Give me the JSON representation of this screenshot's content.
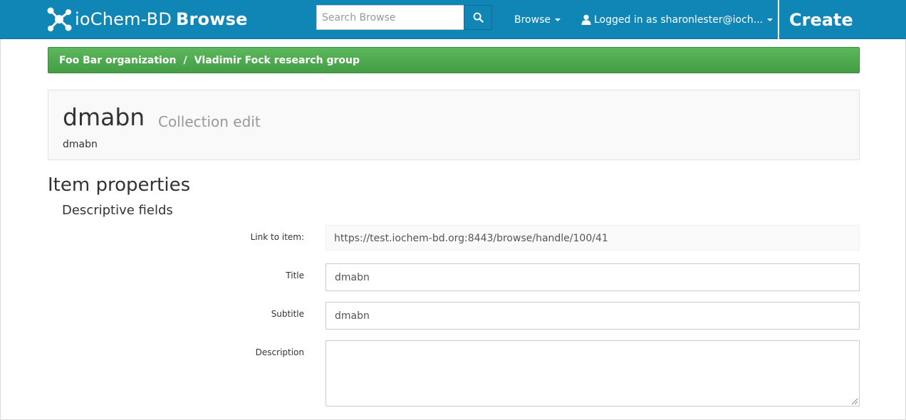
{
  "navbar": {
    "brand_name": "ioChem-BD",
    "brand_section": "Browse",
    "search_placeholder": "Search Browse",
    "browse_menu_label": "Browse",
    "user_menu_label": "Logged in as sharonlester@ioch...",
    "create_label": "Create",
    "bg_color": "#0f86b5"
  },
  "breadcrumb": {
    "items": [
      "Foo Bar organization",
      "Vladimir Fock research group"
    ],
    "separator": "/",
    "bg_color": "#5cb85c"
  },
  "header": {
    "title": "dmabn",
    "subtitle": "Collection edit",
    "description": "dmabn"
  },
  "main": {
    "section_title": "Item properties",
    "subsection_title": "Descriptive fields",
    "fields": {
      "link_label": "Link to item:",
      "link_value": "https://test.iochem-bd.org:8443/browse/handle/100/41",
      "title_label": "Title",
      "title_value": "dmabn",
      "subtitle_label": "Subtitle",
      "subtitle_value": "dmabn",
      "description_label": "Description",
      "description_value": ""
    }
  }
}
